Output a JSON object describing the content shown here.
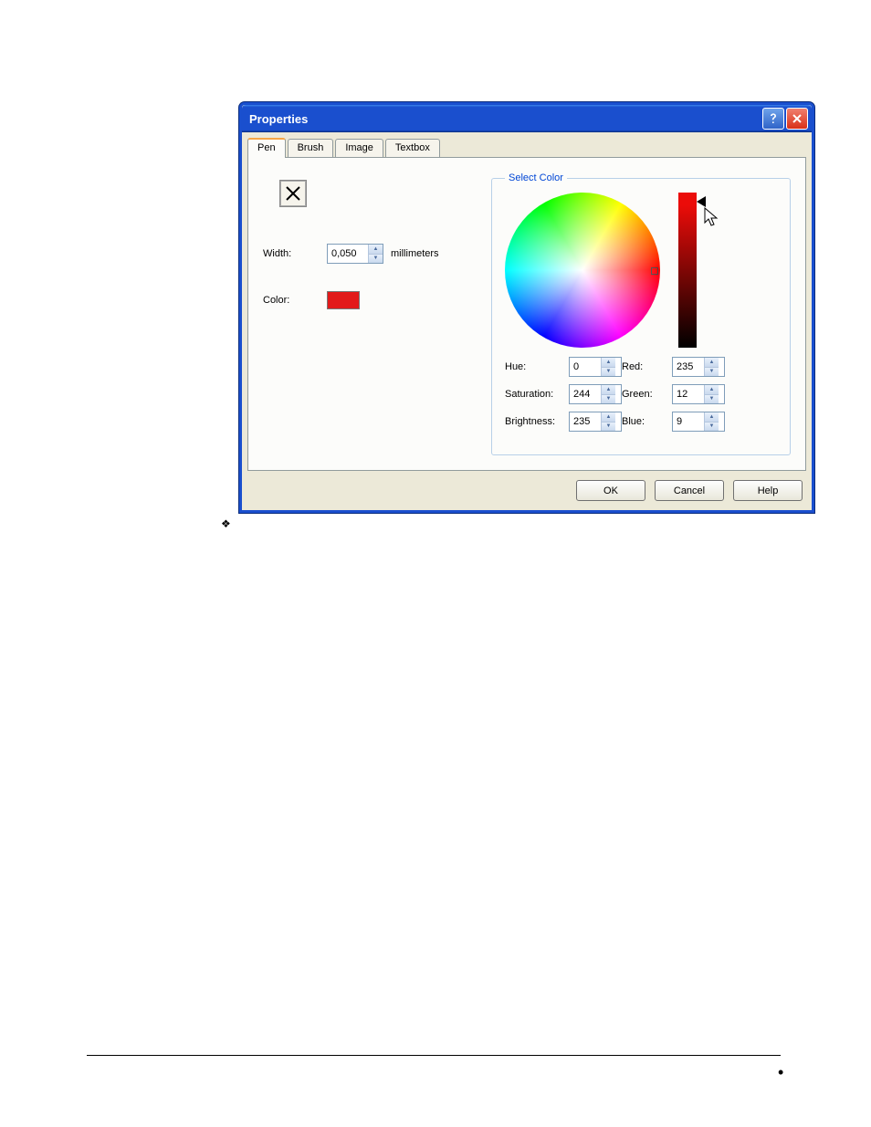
{
  "dialog": {
    "title": "Properties",
    "tabs": [
      "Pen",
      "Brush",
      "Image",
      "Textbox"
    ],
    "active_tab_index": 0,
    "tool_icon": "x-icon",
    "width_label": "Width:",
    "width_value": "0,050",
    "width_unit": "millimeters",
    "color_label": "Color:",
    "color_swatch_hex": "#e21a1a",
    "select_color": {
      "legend": "Select Color",
      "hue_label": "Hue:",
      "hue_value": "0",
      "saturation_label": "Saturation:",
      "saturation_value": "244",
      "brightness_label": "Brightness:",
      "brightness_value": "235",
      "red_label": "Red:",
      "red_value": "235",
      "green_label": "Green:",
      "green_value": "12",
      "blue_label": "Blue:",
      "blue_value": "9"
    },
    "buttons": {
      "ok": "OK",
      "cancel": "Cancel",
      "help": "Help"
    }
  }
}
